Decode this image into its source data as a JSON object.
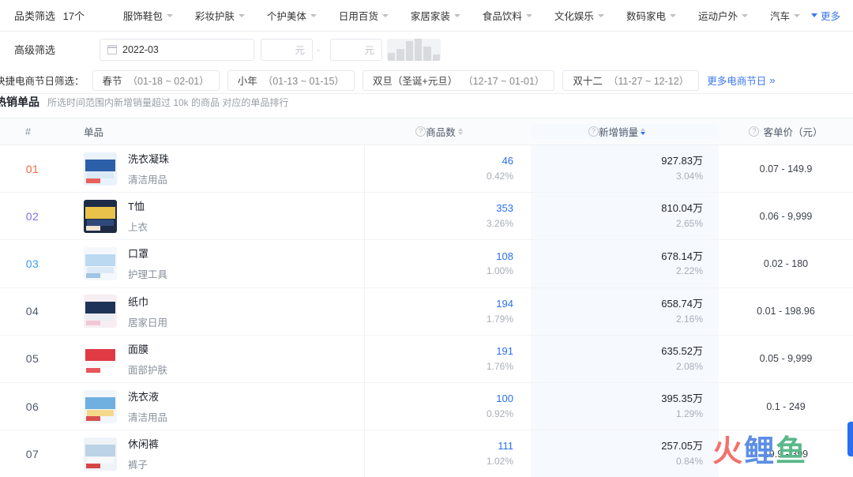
{
  "category_bar": {
    "title": "品类筛选",
    "count": "17个",
    "items": [
      {
        "label": "服饰鞋包"
      },
      {
        "label": "彩妆护肤"
      },
      {
        "label": "个护美体"
      },
      {
        "label": "日用百货"
      },
      {
        "label": "家居家装"
      },
      {
        "label": "食品饮料"
      },
      {
        "label": "文化娱乐"
      },
      {
        "label": "数码家电"
      },
      {
        "label": "运动户外"
      },
      {
        "label": "汽车"
      }
    ],
    "more_label": "更多"
  },
  "advanced_filter": {
    "label": "高级筛选",
    "date_value": "2022-03",
    "price_min_placeholder": "元",
    "price_max_placeholder": "元",
    "separator": "-"
  },
  "festival_bar": {
    "label": "快捷电商节日筛选：",
    "chips": [
      {
        "name": "春节",
        "range": "（01-18 ~ 02-01）"
      },
      {
        "name": "小年",
        "range": "（01-13 ~ 01-15）"
      },
      {
        "name": "双旦（圣诞+元旦）",
        "range": "（12-17 ~ 01-01）"
      },
      {
        "name": "双十二",
        "range": "（11-27 ~ 12-12）"
      }
    ],
    "more_label": "更多电商节日",
    "more_arrow": "»"
  },
  "section": {
    "title": "热销单品",
    "subtitle": "所选时间范围内新增销量超过 10k 的商品 对应的单品排行"
  },
  "table": {
    "columns": {
      "rank": "#",
      "item": "单品",
      "count": "商品数",
      "sales": "新增销量",
      "price": "客单价（元）"
    },
    "sort": {
      "count_state": "none",
      "sales_state": "desc"
    },
    "rows": [
      {
        "rank": "01",
        "rank_color": "rank-1",
        "name": "洗衣凝珠",
        "category": "清洁用品",
        "count": "46",
        "count_pct": "0.42%",
        "sales": "927.83万",
        "sales_pct": "3.04%",
        "price": "0.07 - 149.9",
        "thumb": [
          "#eaf2fb",
          "#2b5fa8",
          "#d9e9f6",
          "#e8605a"
        ]
      },
      {
        "rank": "02",
        "rank_color": "rank-2",
        "name": "T恤",
        "category": "上衣",
        "count": "353",
        "count_pct": "3.26%",
        "sales": "810.04万",
        "sales_pct": "2.65%",
        "price": "0.06 - 9,999",
        "thumb": [
          "#1d2b46",
          "#e8c24a",
          "#2f4a7a",
          "#f0e6d2"
        ]
      },
      {
        "rank": "03",
        "rank_color": "rank-3",
        "name": "口罩",
        "category": "护理工具",
        "count": "108",
        "count_pct": "1.00%",
        "sales": "678.14万",
        "sales_pct": "2.22%",
        "price": "0.02 - 180",
        "thumb": [
          "#f4f7fb",
          "#bcd9f2",
          "#dceaf7",
          "#9fc4e5"
        ]
      },
      {
        "rank": "04",
        "rank_color": "rank-n",
        "name": "纸巾",
        "category": "居家日用",
        "count": "194",
        "count_pct": "1.79%",
        "sales": "658.74万",
        "sales_pct": "2.16%",
        "price": "0.01 - 198.96",
        "thumb": [
          "#f7eef2",
          "#1e3358",
          "#e9edf4",
          "#f3c8d6"
        ]
      },
      {
        "rank": "05",
        "rank_color": "rank-n",
        "name": "面膜",
        "category": "面部护肤",
        "count": "191",
        "count_pct": "1.76%",
        "sales": "635.52万",
        "sales_pct": "2.08%",
        "price": "0.05 - 9,999",
        "thumb": [
          "#ffffff",
          "#e03a44",
          "#f7f7f7",
          "#e8555c"
        ]
      },
      {
        "rank": "06",
        "rank_color": "rank-n",
        "name": "洗衣液",
        "category": "清洁用品",
        "count": "100",
        "count_pct": "0.92%",
        "sales": "395.35万",
        "sales_pct": "1.29%",
        "price": "0.1 - 249",
        "thumb": [
          "#f2f6fa",
          "#6fb0e0",
          "#f5d98a",
          "#d94f4f"
        ]
      },
      {
        "rank": "07",
        "rank_color": "rank-n",
        "name": "休闲裤",
        "category": "裤子",
        "count": "111",
        "count_pct": "1.02%",
        "sales": "257.05万",
        "sales_pct": "0.84%",
        "price": "19.9 - 399",
        "thumb": [
          "#eef3f8",
          "#bcd3e6",
          "#f6f8fa",
          "#d64545"
        ]
      }
    ]
  },
  "watermark": {
    "char1": "火",
    "char2": "鲤",
    "char3": "鱼"
  }
}
